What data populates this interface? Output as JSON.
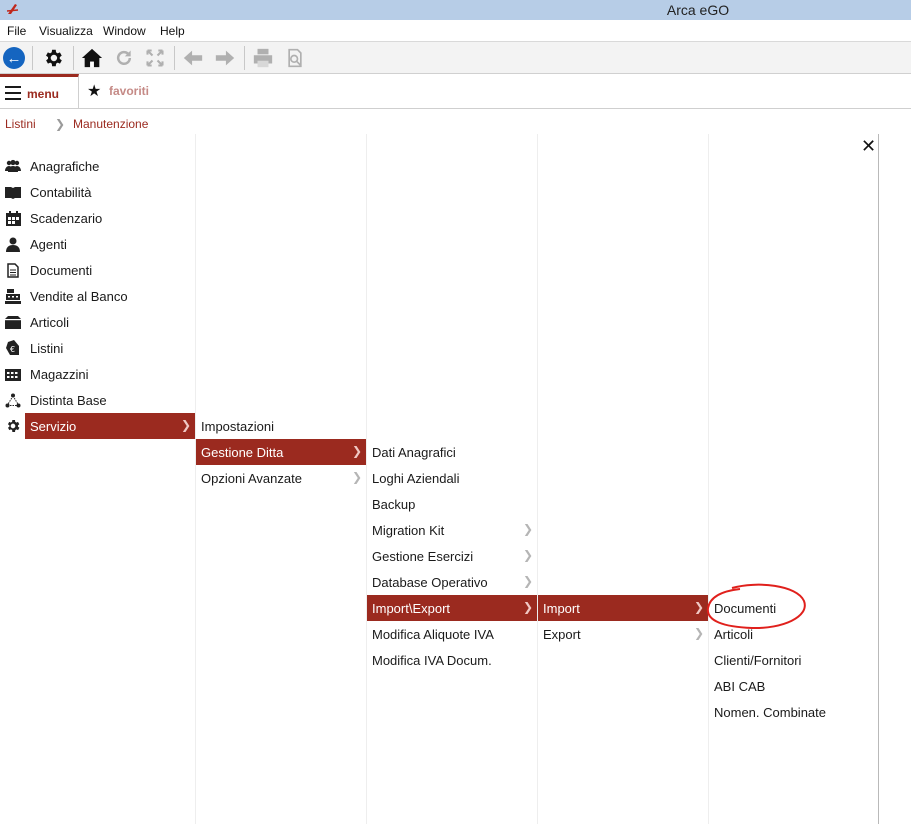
{
  "window": {
    "title": "Arca eGO"
  },
  "menubar": [
    "File",
    "Visualizza",
    "Window",
    "Help"
  ],
  "toolbar": {
    "icons": [
      "back-icon",
      "gear-icon",
      "home-icon",
      "refresh-icon",
      "fullscreen-icon",
      "arrow-left-icon",
      "arrow-right-icon",
      "print-icon",
      "print-preview-icon"
    ]
  },
  "tabs": {
    "menu": "menu",
    "favoriti": "favoriti"
  },
  "breadcrumb": [
    "Listini",
    "Manutenzione"
  ],
  "colors": {
    "accent": "#9b2a1f",
    "titlebar": "#b7cde7",
    "annotation": "#e0201c"
  },
  "level1": [
    {
      "label": "Anagrafiche",
      "icon": "users-icon"
    },
    {
      "label": "Contabilità",
      "icon": "book-icon"
    },
    {
      "label": "Scadenzario",
      "icon": "calendar-icon"
    },
    {
      "label": "Agenti",
      "icon": "agent-icon"
    },
    {
      "label": "Documenti",
      "icon": "document-icon"
    },
    {
      "label": "Vendite al Banco",
      "icon": "cash-register-icon"
    },
    {
      "label": "Articoli",
      "icon": "box-icon"
    },
    {
      "label": "Listini",
      "icon": "price-tag-icon"
    },
    {
      "label": "Magazzini",
      "icon": "warehouse-icon"
    },
    {
      "label": "Distinta Base",
      "icon": "hierarchy-icon"
    },
    {
      "label": "Servizio",
      "icon": "gear-icon",
      "selected": true,
      "submenu": true
    }
  ],
  "level2": [
    {
      "label": "Impostazioni"
    },
    {
      "label": "Gestione Ditta",
      "selected": true,
      "submenu": true
    },
    {
      "label": "Opzioni Avanzate",
      "submenu": true
    }
  ],
  "level3": [
    {
      "label": "Dati Anagrafici"
    },
    {
      "label": "Loghi Aziendali"
    },
    {
      "label": "Backup"
    },
    {
      "label": "Migration Kit",
      "submenu": true
    },
    {
      "label": "Gestione Esercizi",
      "submenu": true
    },
    {
      "label": "Database Operativo",
      "submenu": true
    },
    {
      "label": "Import\\Export",
      "selected": true,
      "submenu": true
    },
    {
      "label": "Modifica Aliquote IVA"
    },
    {
      "label": "Modifica IVA Docum."
    }
  ],
  "level4": [
    {
      "label": "Import",
      "selected": true,
      "submenu": true
    },
    {
      "label": "Export",
      "submenu": true
    }
  ],
  "level5": [
    {
      "label": "Documenti",
      "circled": true
    },
    {
      "label": "Articoli"
    },
    {
      "label": "Clienti/Fornitori"
    },
    {
      "label": "ABI CAB"
    },
    {
      "label": "Nomen. Combinate"
    }
  ]
}
